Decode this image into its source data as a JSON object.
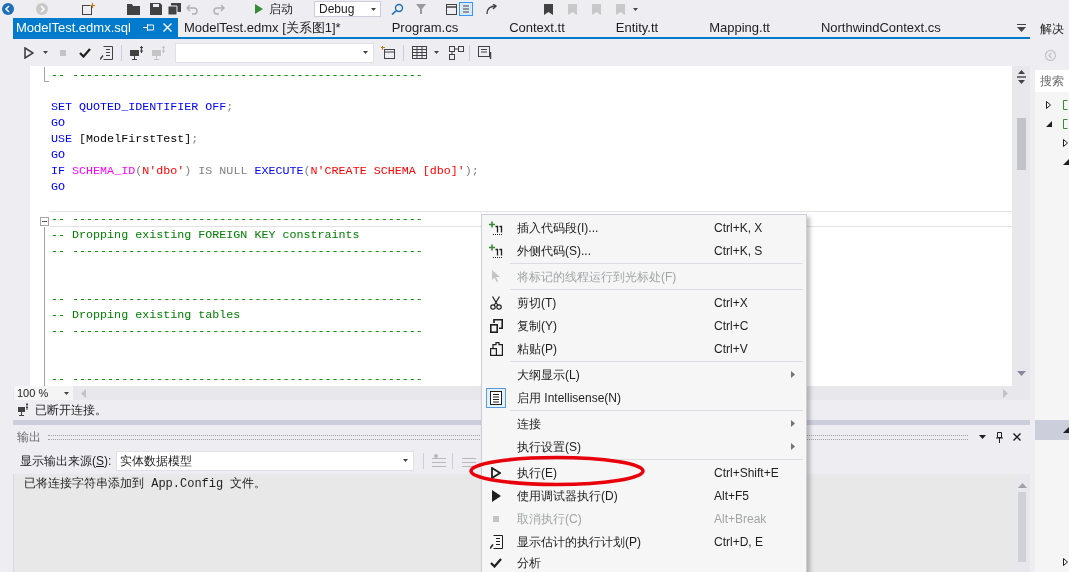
{
  "toolbar": {
    "start_label": "启动",
    "configuration": "Debug"
  },
  "tabs": [
    {
      "label": "ModelTest.edmx.sql",
      "selected": true
    },
    {
      "label": "ModelTest.edmx [关系图1]*",
      "selected": false
    },
    {
      "label": "Program.cs",
      "selected": false
    },
    {
      "label": "Context.tt",
      "selected": false
    },
    {
      "label": "Entity.tt",
      "selected": false
    },
    {
      "label": "Mapping.tt",
      "selected": false
    },
    {
      "label": "NorthwindContext.cs",
      "selected": false
    }
  ],
  "editor": {
    "lines": [
      {
        "kind": "end",
        "current": false,
        "tokens": [
          {
            "kind": "comment",
            "text": "-- --------------------------------------------------"
          }
        ]
      },
      {
        "kind": "plain",
        "current": false
      },
      {
        "kind": "plain",
        "current": false,
        "tokens": [
          {
            "kind": "keyword",
            "text": "SET QUOTED_IDENTIFIER OFF"
          },
          {
            "kind": "operator",
            "text": ";"
          }
        ]
      },
      {
        "kind": "plain",
        "current": false,
        "tokens": [
          {
            "kind": "keyword",
            "text": "GO"
          }
        ]
      },
      {
        "kind": "plain",
        "current": false,
        "tokens": [
          {
            "kind": "keyword",
            "text": "USE"
          },
          {
            "kind": "plain",
            "text": " [ModelFirstTest]"
          },
          {
            "kind": "operator",
            "text": ";"
          }
        ]
      },
      {
        "kind": "plain",
        "current": false,
        "tokens": [
          {
            "kind": "keyword",
            "text": "GO"
          }
        ]
      },
      {
        "kind": "plain",
        "current": false,
        "tokens": [
          {
            "kind": "keyword",
            "text": "IF "
          },
          {
            "kind": "function",
            "text": "SCHEMA_ID"
          },
          {
            "kind": "operator",
            "text": "("
          },
          {
            "kind": "string",
            "text": "N'dbo'"
          },
          {
            "kind": "operator",
            "text": ") IS NULL "
          },
          {
            "kind": "keyword",
            "text": "EXECUTE"
          },
          {
            "kind": "operator",
            "text": "("
          },
          {
            "kind": "string",
            "text": "N'CREATE SCHEMA [dbo]'"
          },
          {
            "kind": "operator",
            "text": ");"
          }
        ]
      },
      {
        "kind": "plain",
        "current": false,
        "tokens": [
          {
            "kind": "keyword",
            "text": "GO"
          }
        ]
      },
      {
        "kind": "plain",
        "current": false
      },
      {
        "kind": "start",
        "current": true,
        "tokens": [
          {
            "kind": "comment",
            "text": "-- --------------------------------------------------"
          }
        ]
      },
      {
        "kind": "body",
        "current": false,
        "tokens": [
          {
            "kind": "comment",
            "text": "-- Dropping existing FOREIGN KEY constraints"
          }
        ]
      },
      {
        "kind": "body",
        "current": false,
        "tokens": [
          {
            "kind": "comment",
            "text": "-- --------------------------------------------------"
          }
        ]
      },
      {
        "kind": "body",
        "current": false
      },
      {
        "kind": "body",
        "current": false
      },
      {
        "kind": "body",
        "current": false,
        "tokens": [
          {
            "kind": "comment",
            "text": "-- --------------------------------------------------"
          }
        ]
      },
      {
        "kind": "body",
        "current": false,
        "tokens": [
          {
            "kind": "comment",
            "text": "-- Dropping existing tables"
          }
        ]
      },
      {
        "kind": "body",
        "current": false,
        "tokens": [
          {
            "kind": "comment",
            "text": "-- --------------------------------------------------"
          }
        ]
      },
      {
        "kind": "body",
        "current": false
      },
      {
        "kind": "body",
        "current": false
      },
      {
        "kind": "body",
        "current": false,
        "tokens": [
          {
            "kind": "comment",
            "text": "-- --------------------------------------------------"
          }
        ]
      }
    ]
  },
  "zoom": "100 %",
  "status": "已断开连接。",
  "output": {
    "title": "输出",
    "source_label": {
      "before": "显示输出来源(",
      "accelerator": "S",
      "after": "):"
    },
    "source": "实体数据模型",
    "text": "已将连接字符串添加到 App.Config 文件。"
  },
  "solution_explorer": {
    "title": "解决",
    "search_placeholder": "搜索",
    "tree": [
      {
        "expanded": false,
        "selected": false
      },
      {
        "expanded": true,
        "selected": false,
        "children": [
          {
            "expanded": false,
            "selected": false
          },
          {
            "expanded": true,
            "selected": false
          },
          {
            "expanded": true,
            "selected": true
          },
          {
            "expanded": false,
            "selected": false
          }
        ]
      }
    ]
  },
  "context_menu": {
    "items": [
      {
        "kind": "item",
        "label": "插入代码段(I)...",
        "shortcut": "Ctrl+K, X",
        "disabled": false,
        "submenu": false,
        "checked": false
      },
      {
        "kind": "item",
        "label": "外侧代码(S)...",
        "shortcut": "Ctrl+K, S",
        "disabled": false,
        "submenu": false,
        "checked": false
      },
      {
        "kind": "separator"
      },
      {
        "kind": "item",
        "label": "将标记的线程运行到光标处(F)",
        "disabled": true,
        "submenu": false,
        "checked": false
      },
      {
        "kind": "separator"
      },
      {
        "kind": "item",
        "label": "剪切(T)",
        "shortcut": "Ctrl+X",
        "disabled": false,
        "submenu": false,
        "checked": false
      },
      {
        "kind": "item",
        "label": "复制(Y)",
        "shortcut": "Ctrl+C",
        "disabled": false,
        "submenu": false,
        "checked": false
      },
      {
        "kind": "item",
        "label": "粘贴(P)",
        "shortcut": "Ctrl+V",
        "disabled": false,
        "submenu": false,
        "checked": false
      },
      {
        "kind": "separator"
      },
      {
        "kind": "item",
        "label": "大纲显示(L)",
        "disabled": false,
        "submenu": true,
        "checked": false
      },
      {
        "kind": "item",
        "label": "启用 Intellisense(N)",
        "disabled": false,
        "submenu": false,
        "checked": true
      },
      {
        "kind": "separator"
      },
      {
        "kind": "item",
        "label": "连接",
        "disabled": false,
        "submenu": true,
        "checked": false
      },
      {
        "kind": "item",
        "label": "执行设置(S)",
        "disabled": false,
        "submenu": true,
        "checked": false
      },
      {
        "kind": "separator"
      },
      {
        "kind": "item",
        "label": "执行(E)",
        "shortcut": "Ctrl+Shift+E",
        "disabled": false,
        "submenu": false,
        "checked": false
      },
      {
        "kind": "item",
        "label": "使用调试器执行(D)",
        "shortcut": "Alt+F5",
        "disabled": false,
        "submenu": false,
        "checked": false
      },
      {
        "kind": "item",
        "label": "取消执行(C)",
        "shortcut": "Alt+Break",
        "disabled": true,
        "submenu": false,
        "checked": false
      },
      {
        "kind": "item",
        "label": "显示估计的执行计划(P)",
        "shortcut": "Ctrl+D, E",
        "disabled": false,
        "submenu": false,
        "checked": false
      },
      {
        "kind": "item",
        "label": "分析",
        "disabled": false,
        "submenu": false,
        "checked": false
      }
    ]
  }
}
